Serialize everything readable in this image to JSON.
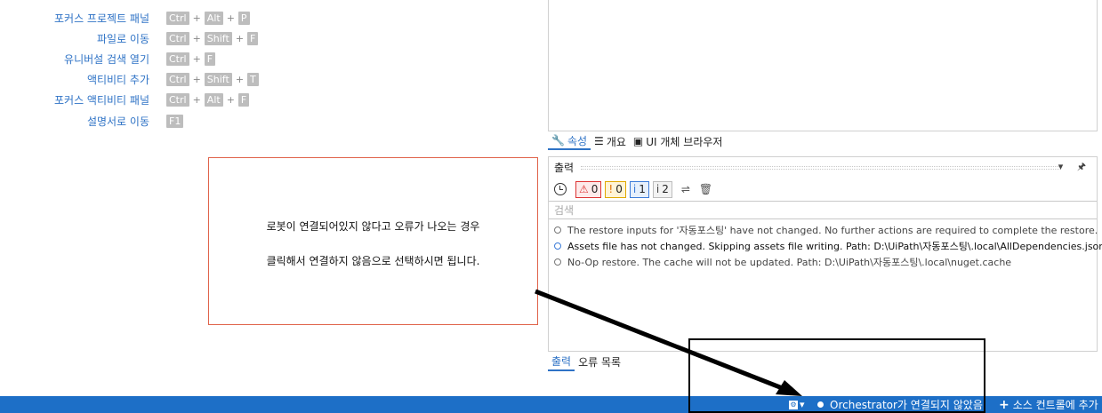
{
  "shortcuts": [
    {
      "label": "포커스 프로젝트 패널",
      "keys": [
        "Ctrl",
        "Alt",
        "P"
      ]
    },
    {
      "label": "파일로 이동",
      "keys": [
        "Ctrl",
        "Shift",
        "F"
      ]
    },
    {
      "label": "유니버설 검색 열기",
      "keys": [
        "Ctrl",
        "F"
      ]
    },
    {
      "label": "액티비티 추가",
      "keys": [
        "Ctrl",
        "Shift",
        "T"
      ]
    },
    {
      "label": "포커스 액티비티 패널",
      "keys": [
        "Ctrl",
        "Alt",
        "F"
      ]
    },
    {
      "label": "설명서로 이동",
      "keys": [
        "F1"
      ]
    }
  ],
  "plus": "+",
  "top_tabs": [
    {
      "label": "속성",
      "icon": "wrench-icon",
      "glyph": "🔧"
    },
    {
      "label": "개요",
      "icon": "outline-icon",
      "glyph": "☰"
    },
    {
      "label": "UI 개체 브라우저",
      "icon": "ui-browser-icon",
      "glyph": "▣"
    }
  ],
  "output": {
    "title": "출력",
    "controls": "▾ 🖈",
    "filters": [
      {
        "kind": "err",
        "glyph": "⚠",
        "count": "0",
        "name": "error-filter"
      },
      {
        "kind": "warn",
        "glyph": "!",
        "count": "0",
        "name": "warning-filter"
      },
      {
        "kind": "info",
        "glyph": "i",
        "count": "1",
        "name": "info-filter"
      },
      {
        "kind": "trace",
        "glyph": "i",
        "count": "2",
        "name": "trace-filter"
      }
    ],
    "search_placeholder": "검색",
    "logs": [
      {
        "text": "The restore inputs for '자동포스팅' have not changed. No further actions are required to complete the restore.",
        "level": "trace"
      },
      {
        "text": "Assets file has not changed. Skipping assets file writing. Path: D:\\UiPath\\자동포스팅\\.local\\AllDependencies.json",
        "level": "info"
      },
      {
        "text": "No-Op restore. The cache will not be updated. Path: D:\\UiPath\\자동포스팅\\.local\\nuget.cache",
        "level": "trace"
      }
    ]
  },
  "bottom_tabs": [
    "출력",
    "오류 목록"
  ],
  "note": {
    "line1": "로봇이 연결되어있지 않다고 오류가 나오는 경우",
    "line2": "클릭해서 연결하지 않음으로 선택하시면 됩니다."
  },
  "statusbar": {
    "robot_arrow": "▾",
    "orchestrator": "Orchestrator가 연결되지 않았음",
    "source_control": "소스 컨트롤에 추가",
    "source_plus": "+"
  },
  "colors": {
    "accent": "#2f73c6",
    "statusbar": "#1d6fc7",
    "note_border": "#e0634a"
  }
}
